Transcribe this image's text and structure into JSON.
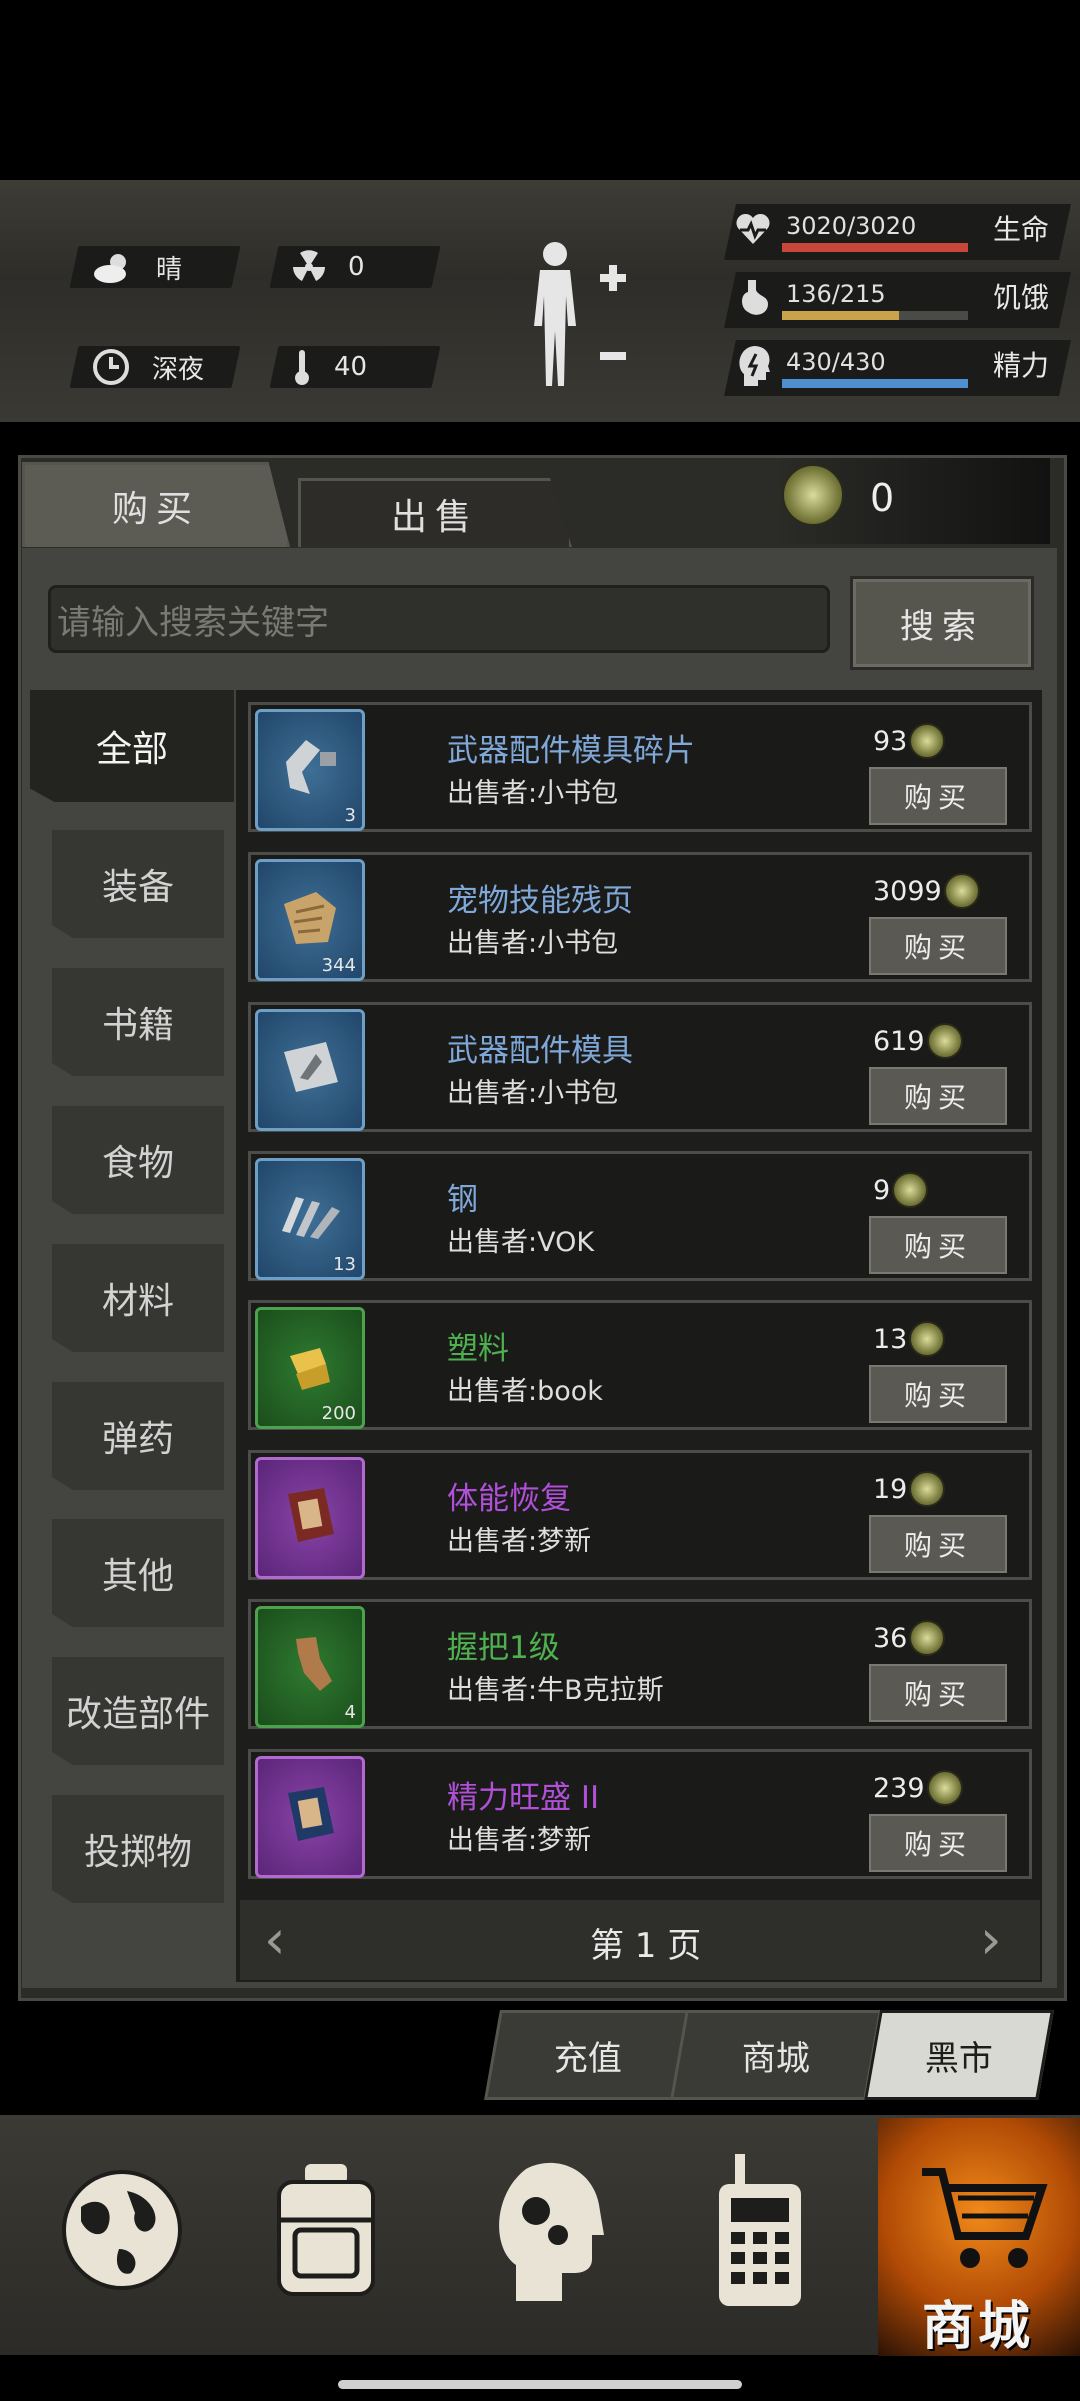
{
  "status": {
    "weather": "晴",
    "radiation": "0",
    "time_of_day": "深夜",
    "temperature": "40",
    "health": {
      "label": "生命",
      "value": "3020/3020",
      "fraction": 1.0,
      "color": "#c8473a"
    },
    "hunger": {
      "label": "饥饿",
      "value": "136/215",
      "fraction": 0.63,
      "color": "#c9a24a"
    },
    "energy": {
      "label": "精力",
      "value": "430/430",
      "fraction": 1.0,
      "color": "#4f8fd0"
    }
  },
  "tabs": {
    "buy": "购买",
    "sell": "出售"
  },
  "currency": {
    "amount": "0"
  },
  "search": {
    "placeholder": "请输入搜索关键字",
    "button": "搜索"
  },
  "categories": [
    "全部",
    "装备",
    "书籍",
    "食物",
    "材料",
    "弹药",
    "其他",
    "改造部件",
    "投掷物"
  ],
  "items": [
    {
      "name": "武器配件模具碎片",
      "seller": "出售者:小书包",
      "price": "93",
      "qty": "3",
      "rarity": "blue",
      "name_color": "#7fa8d8",
      "icon": "mold-fragment-icon",
      "buy": "购买"
    },
    {
      "name": "宠物技能残页",
      "seller": "出售者:小书包",
      "price": "3099",
      "qty": "344",
      "rarity": "blue",
      "name_color": "#7fa8d8",
      "icon": "torn-page-icon",
      "buy": "购买"
    },
    {
      "name": "武器配件模具",
      "seller": "出售者:小书包",
      "price": "619",
      "qty": "",
      "rarity": "blue",
      "name_color": "#7fa8d8",
      "icon": "weapon-mold-icon",
      "buy": "购买"
    },
    {
      "name": "钢",
      "seller": "出售者:VOK",
      "price": "9",
      "qty": "13",
      "rarity": "blue",
      "name_color": "#7fa8d8",
      "icon": "steel-icon",
      "buy": "购买"
    },
    {
      "name": "塑料",
      "seller": "出售者:book",
      "price": "13",
      "qty": "200",
      "rarity": "green",
      "name_color": "#4fb04f",
      "icon": "plastic-icon",
      "buy": "购买"
    },
    {
      "name": "体能恢复",
      "seller": "出售者:梦新",
      "price": "19",
      "qty": "",
      "rarity": "purple",
      "name_color": "#b050d8",
      "icon": "skill-book-icon",
      "buy": "购买"
    },
    {
      "name": "握把1级",
      "seller": "出售者:牛B克拉斯",
      "price": "36",
      "qty": "4",
      "rarity": "green",
      "name_color": "#4fb04f",
      "icon": "grip-icon",
      "buy": "购买"
    },
    {
      "name": "精力旺盛 II",
      "seller": "出售者:梦新",
      "price": "239",
      "qty": "",
      "rarity": "purple",
      "name_color": "#b050d8",
      "icon": "skill-book-blue-icon",
      "buy": "购买"
    }
  ],
  "pager": {
    "label": "第 1 页"
  },
  "bottom_tabs": [
    "充值",
    "商城",
    "黑市"
  ],
  "nav": {
    "shop_label": "商城"
  }
}
